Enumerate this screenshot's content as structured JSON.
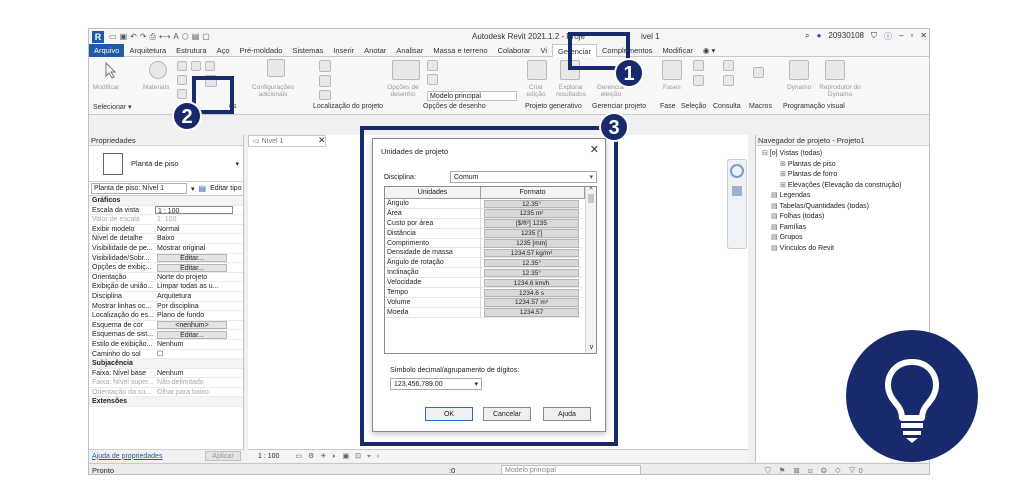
{
  "app": {
    "title": "Autodesk Revit 2021.1.2 - Proje",
    "title_suffix": "ivel 1",
    "user": "20930108",
    "qat_icons": [
      "open-icon",
      "save-icon",
      "undo-icon",
      "redo-icon",
      "print-icon"
    ]
  },
  "tabs": [
    "Arquivo",
    "Arquitetura",
    "Estrutura",
    "Aço",
    "Pré-moldado",
    "Sistemas",
    "Inserir",
    "Anotar",
    "Analisar",
    "Massa e terreno",
    "Colaborar",
    "Vi",
    "Gerenciar",
    "Complementos",
    "Modificar"
  ],
  "ribbon": {
    "modificar": "Modificar",
    "materiais": "Materiais",
    "configuracoes": "Configurações adicionais",
    "opcoes_desenho_btn": "Opções de desenho",
    "modelo_principal": "Modelo principal",
    "criar_edicao": "Criar edição",
    "explorar": "Explorar resultados",
    "gerenciar_eleicao": "Gerenciar eleição",
    "fases": "Fases",
    "dynamo": "Dynamo",
    "reprodutor": "Reprodutor do Dynamo",
    "groups": {
      "selecionar": "Selecionar ▾",
      "configuracoes_short": "es",
      "localizacao": "Localização do projeto",
      "opcoes_desenho": "Opções de desenho",
      "projeto_generativo": "Projeto generativo",
      "gerenciar_projeto": "Gerenciar projeto",
      "fase": "Fase",
      "selecao": "Seleção",
      "consulta": "Consulta",
      "macros": "Macros",
      "programacao_visual": "Programação visual"
    }
  },
  "properties": {
    "title": "Propriedades",
    "type_name": "Planta de piso",
    "instance": "Planta de piso: Nível 1",
    "edit_type": "Editar tipo",
    "section_graficos": "Gráficos",
    "rows": [
      {
        "k": "Escala da vista",
        "v": "1 : 100",
        "box": true
      },
      {
        "k": "Valor de escala",
        "v": "1:  100",
        "grey": true
      },
      {
        "k": "Exibir modelo",
        "v": "Normal"
      },
      {
        "k": "Nível de detalhe",
        "v": "Baixo"
      },
      {
        "k": "Visibilidade de pe...",
        "v": "Mostrar original"
      },
      {
        "k": "Visibilidade/Sobr...",
        "v": "Editar...",
        "button": true
      },
      {
        "k": "Opções de exibiç...",
        "v": "Editar...",
        "button": true
      },
      {
        "k": "Orientação",
        "v": "Norte do projeto"
      },
      {
        "k": "Exibição de união...",
        "v": "Limpar todas as u..."
      },
      {
        "k": "Disciplina",
        "v": "Arquitetura"
      },
      {
        "k": "Mostrar linhas oc...",
        "v": "Por disciplina"
      },
      {
        "k": "Localização do es...",
        "v": "Plano de fundo"
      },
      {
        "k": "Esquema de cor",
        "v": "<nenhum>",
        "button": true
      },
      {
        "k": "Esquemas de sist...",
        "v": "Editar...",
        "button": true
      },
      {
        "k": "Estilo de exibição...",
        "v": "Nenhum"
      },
      {
        "k": "Caminho do sol",
        "v": "☐"
      }
    ],
    "section_subjacencia": "Subjacência",
    "rows2": [
      {
        "k": "Faixa: Nível base",
        "v": "Nenhum"
      },
      {
        "k": "Faixa: Nível super...",
        "v": "Não delimitado",
        "grey": true
      },
      {
        "k": "Orientação da su...",
        "v": "Olhar para baixo",
        "grey": true
      }
    ],
    "section_extensoes": "Extensões",
    "help_link": "Ajuda de propriedades",
    "apply": "Aplicar"
  },
  "view": {
    "tab": "Nível 1",
    "scale": "1 : 100"
  },
  "browser": {
    "title": "Navegador de projeto - Projeto1",
    "items": [
      {
        "label": "[o] Vistas (todas)",
        "indent": 0
      },
      {
        "label": "Plantas de piso",
        "indent": 2
      },
      {
        "label": "Plantas de forro",
        "indent": 2
      },
      {
        "label": "Elevações (Elevação da construção)",
        "indent": 2
      },
      {
        "label": "Legendas",
        "indent": 1
      },
      {
        "label": "Tabelas/Quantidades (todas)",
        "indent": 1
      },
      {
        "label": "Folhas (todas)",
        "indent": 1
      },
      {
        "label": "Famílias",
        "indent": 1
      },
      {
        "label": "Grupos",
        "indent": 1
      },
      {
        "label": "Vínculos do Revit",
        "indent": 1
      }
    ]
  },
  "status": {
    "left": "Pronto",
    "field": "Modelo principal",
    "zero": ":0"
  },
  "dialog": {
    "title": "Unidades de projeto",
    "discipline_label": "Disciplina:",
    "discipline_value": "Comum",
    "col_units": "Unidades",
    "col_format": "Formato",
    "rows": [
      {
        "u": "Ângulo",
        "f": "12.35°"
      },
      {
        "u": "Área",
        "f": "1235 m²"
      },
      {
        "u": "Custo por área",
        "f": "[$/ft²] 1235"
      },
      {
        "u": "Distância",
        "f": "1235 [']"
      },
      {
        "u": "Comprimento",
        "f": "1235 [mm]"
      },
      {
        "u": "Densidade de massa",
        "f": "1234.57 kg/m³"
      },
      {
        "u": "Ângulo de rotação",
        "f": "12.35°"
      },
      {
        "u": "Inclinação",
        "f": "12.35°"
      },
      {
        "u": "Velocidade",
        "f": "1234.6 km/h"
      },
      {
        "u": "Tempo",
        "f": "1234.6 s"
      },
      {
        "u": "Volume",
        "f": "1234.57 m³"
      },
      {
        "u": "Moeda",
        "f": "1234.57"
      }
    ],
    "symbol_label": "Símbolo decimal/agrupamento de dígitos:",
    "symbol_value": "123,456,789.00",
    "ok": "OK",
    "cancel": "Cancelar",
    "help": "Ajuda"
  },
  "callouts": {
    "one": "1",
    "two": "2",
    "three": "3"
  },
  "colors": {
    "highlight": "#182a6b",
    "revit_blue": "#1f5aa6"
  }
}
